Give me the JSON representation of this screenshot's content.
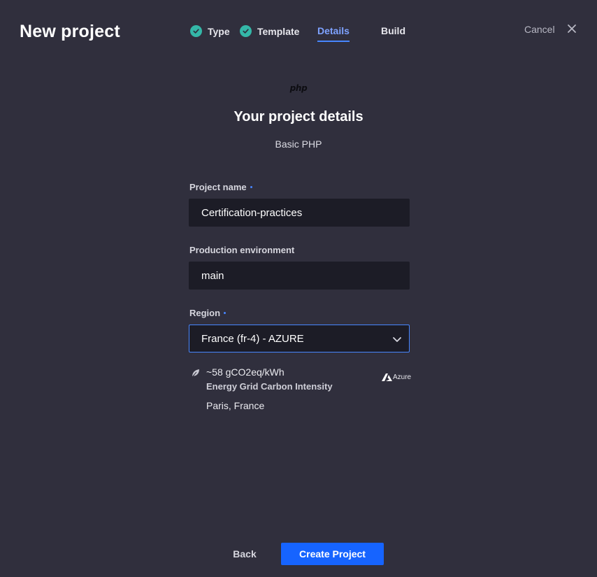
{
  "header": {
    "title": "New project",
    "cancel_label": "Cancel",
    "close_icon": "close-icon"
  },
  "steps": [
    {
      "label": "Type",
      "state": "completed",
      "icon": "check-circle-icon"
    },
    {
      "label": "Template",
      "state": "completed",
      "icon": "check-circle-icon"
    },
    {
      "label": "Details",
      "state": "active"
    },
    {
      "label": "Build",
      "state": "pending"
    }
  ],
  "main": {
    "logo_text": "php",
    "heading": "Your project details",
    "subheading": "Basic PHP"
  },
  "form": {
    "project_name": {
      "label": "Project name",
      "value": "Certification-practices",
      "required": true
    },
    "production_environment": {
      "label": "Production environment",
      "value": "main"
    },
    "region": {
      "label": "Region",
      "value": "France (fr-4) - AZURE",
      "required": true
    }
  },
  "region_info": {
    "carbon_value": "~58 gCO2eq/kWh",
    "carbon_label": "Energy Grid Carbon Intensity",
    "provider": "Azure",
    "location": "Paris, France"
  },
  "footer": {
    "back_label": "Back",
    "create_label": "Create Project"
  },
  "colors": {
    "background": "#302f3d",
    "input_background": "#1c1c26",
    "accent": "#4786ff",
    "primary_button": "#1664ff",
    "check": "#34b7a8"
  }
}
